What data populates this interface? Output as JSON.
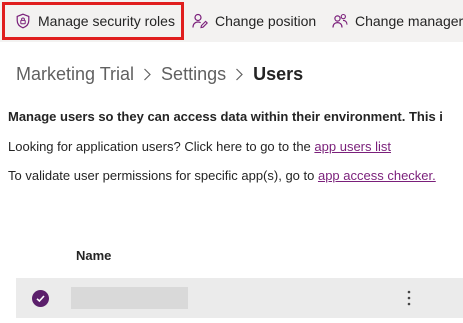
{
  "toolbar": {
    "manage_roles": {
      "label": "Manage security roles",
      "icon": "shield-lock-icon"
    },
    "change_position": {
      "label": "Change position",
      "icon": "person-edit-icon"
    },
    "change_manager": {
      "label": "Change manager",
      "icon": "people-icon"
    }
  },
  "breadcrumb": {
    "items": [
      "Marketing Trial",
      "Settings",
      "Users"
    ]
  },
  "content": {
    "intro": "Manage users so they can access data within their environment. This i",
    "app_users_prefix": "Looking for application users? Click here to go to the ",
    "app_users_link": "app users list",
    "access_checker_prefix": "To validate user permissions for specific app(s), go to ",
    "access_checker_link": "app access checker."
  },
  "table": {
    "columns": [
      "Name"
    ],
    "rows": [
      {
        "selected": true,
        "name": ""
      }
    ]
  },
  "colors": {
    "accent": "#7a1f7a",
    "highlight_border": "#e01e1e",
    "toolbar_bg": "#f3f2f1",
    "row_bg": "#ebebeb"
  }
}
